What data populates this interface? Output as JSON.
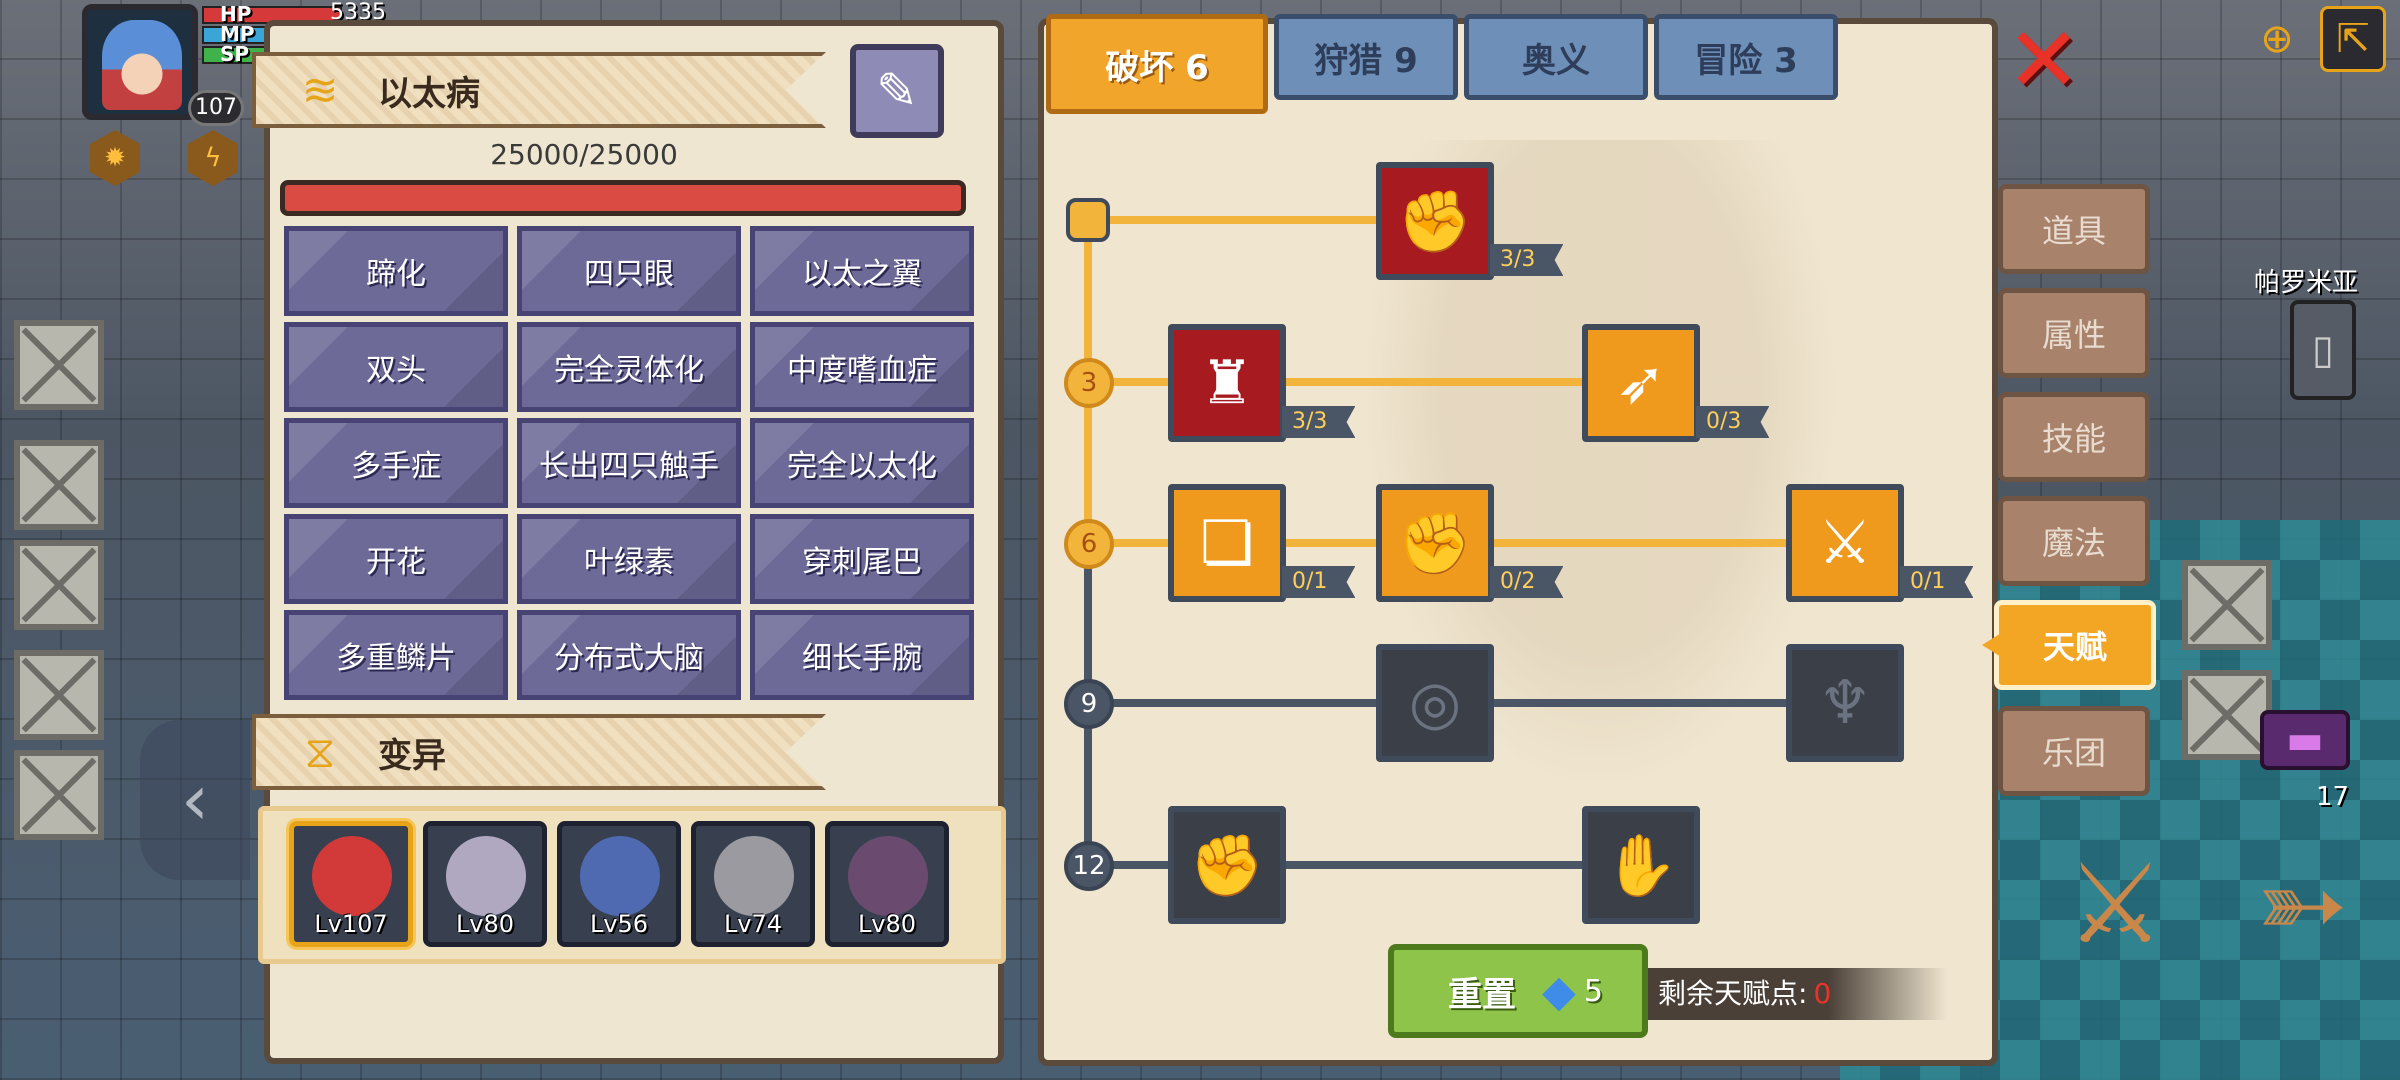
{
  "hud": {
    "hp_label": "HP",
    "mp_label": "MP",
    "sp_label": "SP",
    "hp_value": "5335",
    "level": "107",
    "bar_colors": {
      "hp": "#d6393a",
      "mp": "#3aa6d8",
      "sp": "#3fb24a"
    }
  },
  "disease": {
    "title": "以太病",
    "icon": "wind-swirl-icon",
    "hp_text": "25000/25000",
    "items": [
      "蹄化",
      "四只眼",
      "以太之翼",
      "双头",
      "完全灵体化",
      "中度嗜血症",
      "多手症",
      "长出四只触手",
      "完全以太化",
      "开花",
      "叶绿素",
      "穿刺尾巴",
      "多重鳞片",
      "分布式大脑",
      "细长手腕"
    ]
  },
  "mutation": {
    "title": "变异",
    "icon": "dna-icon",
    "pets": [
      {
        "level": "Lv107",
        "art": "#d23a3a",
        "selected": true
      },
      {
        "level": "Lv80",
        "art": "#b0a8c0",
        "selected": false
      },
      {
        "level": "Lv56",
        "art": "#4f6ab0",
        "selected": false
      },
      {
        "level": "Lv74",
        "art": "#9a9aa0",
        "selected": false
      },
      {
        "level": "Lv80",
        "art": "#6a4a6e",
        "selected": false
      }
    ]
  },
  "tabs": [
    "破坏 6",
    "狩猎 9",
    "奥义",
    "冒险 3"
  ],
  "talent_tree": {
    "tiers": [
      "3",
      "6",
      "9",
      "12"
    ],
    "nodes": [
      {
        "name": "arm-wrestle-icon",
        "count": "3/3",
        "style": "red"
      },
      {
        "name": "muscle-body-icon",
        "count": "3/3",
        "style": "red"
      },
      {
        "name": "arrow-strike-icon",
        "count": "0/3",
        "style": "orange"
      },
      {
        "name": "card-slash-icon",
        "count": "0/1",
        "style": "orange"
      },
      {
        "name": "punch-icon",
        "count": "0/2",
        "style": "orange"
      },
      {
        "name": "splash-sword-icon",
        "count": "0/1",
        "style": "orange"
      },
      {
        "name": "shockwave-icon",
        "count": "",
        "style": "locked"
      },
      {
        "name": "bat-wing-icon",
        "count": "",
        "style": "locked"
      },
      {
        "name": "fist-icon",
        "count": "",
        "style": "locked"
      },
      {
        "name": "gauntlet-icon",
        "count": "",
        "style": "locked"
      }
    ]
  },
  "reset": {
    "label": "重置",
    "gem_cost": "5"
  },
  "remaining": {
    "label": "剩余天赋点:",
    "value": "0"
  },
  "side_menu": [
    "道具",
    "属性",
    "技能",
    "魔法",
    "天赋",
    "乐团"
  ],
  "world": {
    "npc_name": "帕罗米亚",
    "potion_count": "17"
  }
}
